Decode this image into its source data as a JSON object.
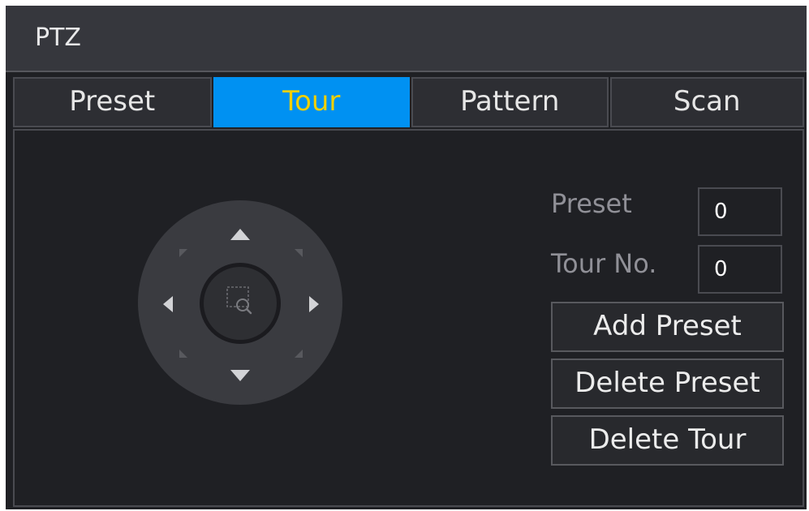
{
  "window": {
    "title": "PTZ"
  },
  "tabs": [
    {
      "label": "Preset",
      "active": false
    },
    {
      "label": "Tour",
      "active": true
    },
    {
      "label": "Pattern",
      "active": false
    },
    {
      "label": "Scan",
      "active": false
    }
  ],
  "fields": {
    "preset_label": "Preset",
    "preset_value": "0",
    "tour_label": "Tour No.",
    "tour_value": "0"
  },
  "buttons": {
    "add_preset": "Add Preset",
    "delete_preset": "Delete Preset",
    "delete_tour": "Delete Tour"
  },
  "control_pad": {
    "icons": [
      "chevron-up-icon",
      "chevron-down-icon",
      "chevron-left-icon",
      "chevron-right-icon",
      "diagonal-arrow-icon",
      "zoom-area-icon"
    ]
  },
  "colors": {
    "background": "#1f2024",
    "titlebar": "#36373d",
    "tab_active_bg": "#0091f2",
    "tab_active_text": "#f1d000",
    "border": "#4a4b51"
  }
}
